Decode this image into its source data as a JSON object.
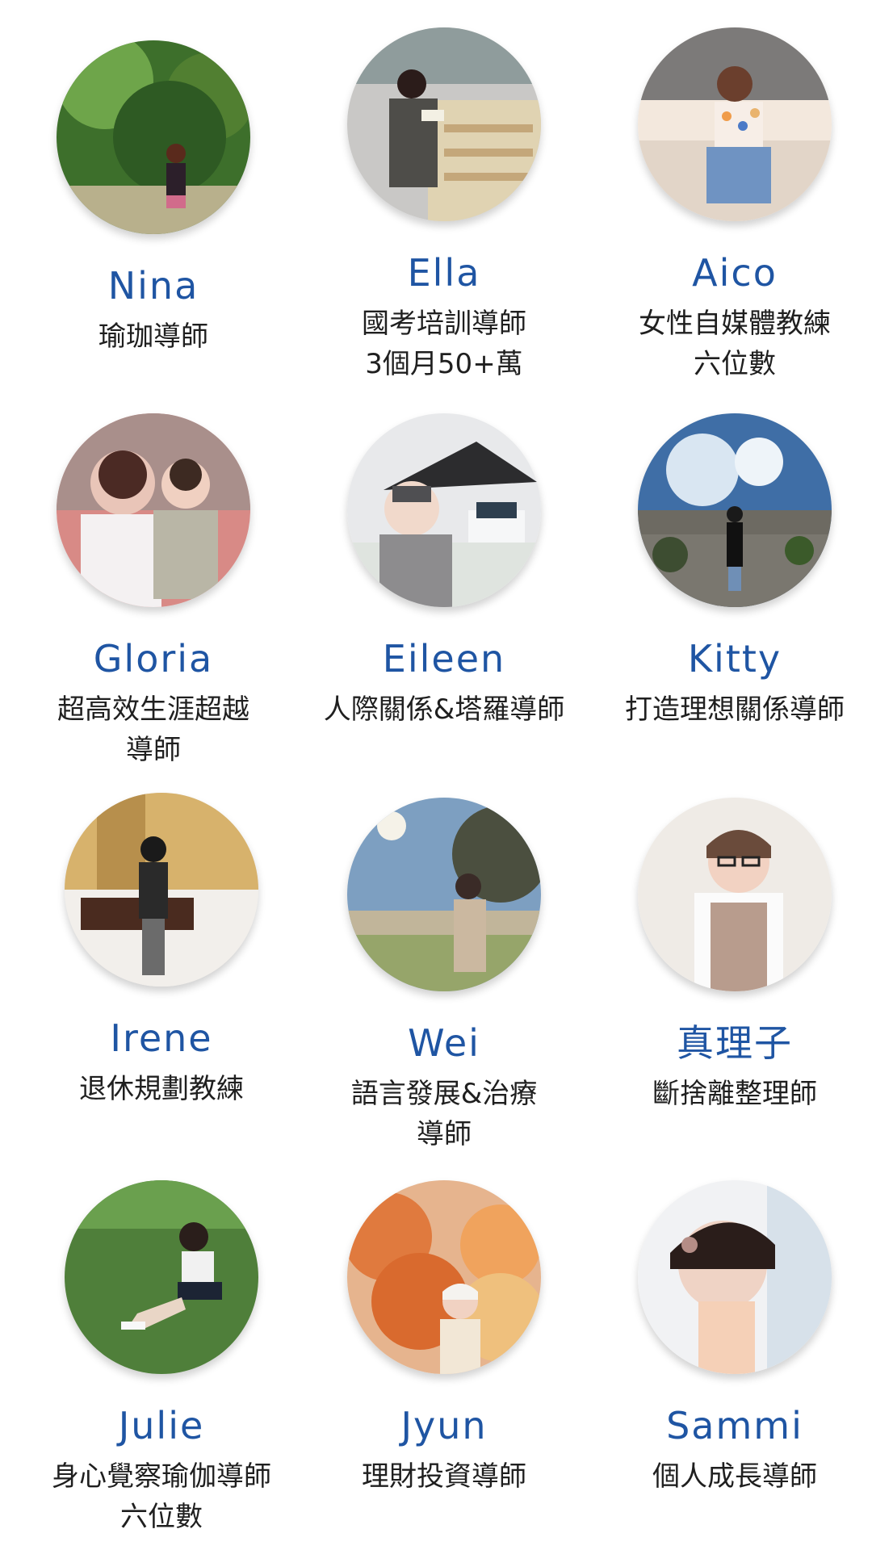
{
  "people": [
    {
      "name": "Nina",
      "role": [
        "瑜珈導師"
      ],
      "avatar": "woman-walking-in-forest"
    },
    {
      "name": "Ella",
      "role": [
        "國考培訓導師",
        "3個月50+萬"
      ],
      "avatar": "woman-reading-book-at-market"
    },
    {
      "name": "Aico",
      "role": [
        "女性自媒體教練",
        "六位數"
      ],
      "avatar": "woman-sitting-on-sofa"
    },
    {
      "name": "Gloria",
      "role": [
        "超高效生涯超越",
        "導師"
      ],
      "avatar": "mother-holding-baby"
    },
    {
      "name": "Eileen",
      "role": [
        "人際關係&塔羅導師"
      ],
      "avatar": "woman-with-umbrella-and-castle"
    },
    {
      "name": "Kitty",
      "role": [
        "打造理想關係導師"
      ],
      "avatar": "woman-on-rocky-landscape"
    },
    {
      "name": "Irene",
      "role": [
        "退休規劃教練"
      ],
      "avatar": "woman-standing-indoors"
    },
    {
      "name": "Wei",
      "role": [
        "語言發展&治療",
        "導師"
      ],
      "avatar": "woman-in-park-under-sun"
    },
    {
      "name": "真理子",
      "role": [
        "斷捨離整理師"
      ],
      "avatar": "woman-with-glasses"
    },
    {
      "name": "Julie",
      "role": [
        "身心覺察瑜伽導師",
        "六位數"
      ],
      "avatar": "woman-sitting-on-grass"
    },
    {
      "name": "Jyun",
      "role": [
        "理財投資導師"
      ],
      "avatar": "woman-with-autumn-leaves"
    },
    {
      "name": "Sammi",
      "role": [
        "個人成長導師"
      ],
      "avatar": "woman-selfie-portrait"
    }
  ]
}
